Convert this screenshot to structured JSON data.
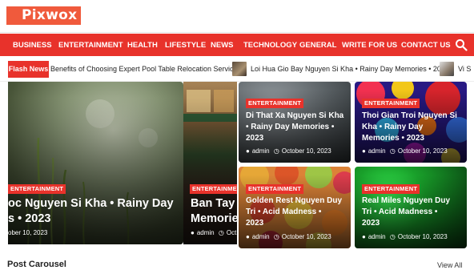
{
  "site": {
    "logo": "Pixwox"
  },
  "nav": {
    "items": [
      "BUSINESS",
      "ENTERTAINMENT",
      "HEALTH",
      "LIFESTYLE",
      "NEWS",
      "TECHNOLOGY",
      "GENERAL",
      "WRITE FOR US",
      "CONTACT US"
    ],
    "search_icon": "search-icon"
  },
  "flash": {
    "label": "Flash News",
    "items": [
      "Benefits of Choosing Expert Pool Table Relocation Services",
      "Loi Hua Gio Bay Nguyen Si Kha • Rainy Day Memories • 2023",
      "Vi S"
    ]
  },
  "cards": [
    {
      "category": "ENTERTAINMENT",
      "title": "oc Nguyen Si Kha • Rainy Day\ns • 2023",
      "author": "",
      "date": "ober 10, 2023"
    },
    {
      "category": "ENTERTAINMENT",
      "title": "Ban Tay I\nMemorie",
      "author": "admin",
      "date": "Oct"
    },
    {
      "category": "ENTERTAINMENT",
      "title": "Di That Xa Nguyen Si Kha\n• Rainy Day Memories •\n2023",
      "author": "admin",
      "date": "October 10, 2023"
    },
    {
      "category": "ENTERTAINMENT",
      "title": "Thoi Gian Troi Nguyen Si\nKha • Rainy Day\nMemories • 2023",
      "author": "admin",
      "date": "October 10, 2023"
    },
    {
      "category": "ENTERTAINMENT",
      "title": "Golden Rest Nguyen Duy\nTri • Acid Madness •\n2023",
      "author": "admin",
      "date": "October 10, 2023"
    },
    {
      "category": "ENTERTAINMENT",
      "title": "Real Miles Nguyen Duy\nTri • Acid Madness •\n2023",
      "author": "admin",
      "date": "October 10, 2023"
    }
  ],
  "section": {
    "title": "Post Carousel",
    "view_all": "View All"
  }
}
